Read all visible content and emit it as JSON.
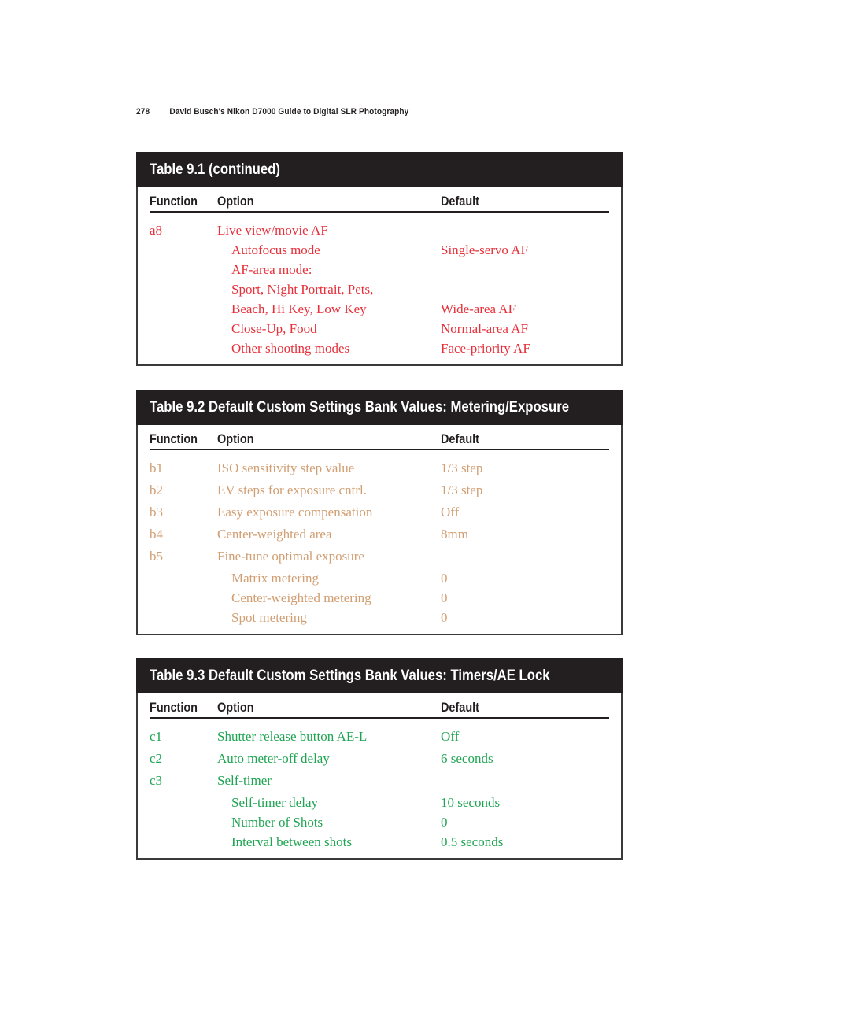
{
  "running_head": {
    "page_number": "278",
    "book_title": "David Busch's Nikon D7000 Guide to Digital SLR Photography"
  },
  "columns": {
    "function": "Function",
    "option": "Option",
    "default": "Default"
  },
  "tables": [
    {
      "title": "Table 9.1  (continued)",
      "text_color": "#e8303a",
      "rows": [
        {
          "function": "a8",
          "option": "Live view/movie AF",
          "default": "",
          "indent": false
        },
        {
          "function": "",
          "option": "Autofocus mode",
          "default": "Single-servo AF",
          "indent": true
        },
        {
          "function": "",
          "option": "AF-area mode:",
          "default": "",
          "indent": true
        },
        {
          "function": "",
          "option": "Sport, Night Portrait, Pets,",
          "default": "",
          "indent": true
        },
        {
          "function": "",
          "option": "Beach, Hi Key, Low Key",
          "default": "Wide-area AF",
          "indent": true
        },
        {
          "function": "",
          "option": "Close-Up, Food",
          "default": "Normal-area AF",
          "indent": true
        },
        {
          "function": "",
          "option": "Other shooting modes",
          "default": "Face-priority AF",
          "indent": true
        }
      ]
    },
    {
      "title": "Table 9.2  Default Custom Settings Bank Values: Metering/Exposure",
      "text_color": "#d19e72",
      "rows": [
        {
          "function": "b1",
          "option": "ISO sensitivity step value",
          "default": "1/3 step",
          "indent": false
        },
        {
          "function": "b2",
          "option": "EV steps for exposure cntrl.",
          "default": "1/3 step",
          "indent": false
        },
        {
          "function": "b3",
          "option": "Easy exposure compensation",
          "default": "Off",
          "indent": false
        },
        {
          "function": "b4",
          "option": "Center-weighted area",
          "default": "8mm",
          "indent": false
        },
        {
          "function": "b5",
          "option": "Fine-tune optimal exposure",
          "default": "",
          "indent": false
        },
        {
          "function": "",
          "option": "Matrix metering",
          "default": "0",
          "indent": true
        },
        {
          "function": "",
          "option": "Center-weighted metering",
          "default": "0",
          "indent": true
        },
        {
          "function": "",
          "option": "Spot metering",
          "default": "0",
          "indent": true
        }
      ]
    },
    {
      "title": "Table 9.3  Default Custom Settings Bank Values: Timers/AE Lock",
      "text_color": "#1fa552",
      "rows": [
        {
          "function": "c1",
          "option": "Shutter release button AE-L",
          "default": "Off",
          "indent": false
        },
        {
          "function": "c2",
          "option": "Auto meter-off delay",
          "default": "6 seconds",
          "indent": false
        },
        {
          "function": "c3",
          "option": "Self-timer",
          "default": "",
          "indent": false
        },
        {
          "function": "",
          "option": "Self-timer delay",
          "default": "10 seconds",
          "indent": true
        },
        {
          "function": "",
          "option": "Number of Shots",
          "default": "0",
          "indent": true
        },
        {
          "function": "",
          "option": "Interval between shots",
          "default": "0.5 seconds",
          "indent": true
        }
      ]
    }
  ]
}
